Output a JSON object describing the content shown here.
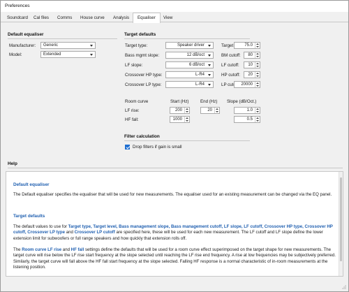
{
  "window": {
    "title": "Preferences"
  },
  "tabs": [
    {
      "label": "Soundcard"
    },
    {
      "label": "Cal files"
    },
    {
      "label": "Comms"
    },
    {
      "label": "House curve"
    },
    {
      "label": "Analysis"
    },
    {
      "label": "Equaliser"
    },
    {
      "label": "View"
    }
  ],
  "default_equaliser": {
    "title": "Default equaliser",
    "manufacturer_label": "Manufacturer:",
    "manufacturer_value": "Generic",
    "model_label": "Model:",
    "model_value": "Extended"
  },
  "target_defaults": {
    "title": "Target defaults",
    "target_type_label": "Target type:",
    "target_type_value": "Speaker driver",
    "bass_slope_label": "Bass mgmt slope:",
    "bass_slope_value": "12 dB/oct",
    "lf_slope_label": "LF slope:",
    "lf_slope_value": "6 dB/oct",
    "xover_hp_type_label": "Crossover HP type:",
    "xover_hp_type_value": "L-R4",
    "xover_lp_type_label": "Crossover LP type:",
    "xover_lp_type_value": "L-R4",
    "target_level_label": "Target level:",
    "target_level_value": "75.0",
    "bm_cutoff_label": "BM cutoff:",
    "bm_cutoff_value": "80",
    "lf_cutoff_label": "LF cutoff:",
    "lf_cutoff_value": "10",
    "hp_cutoff_label": "HP cutoff:",
    "hp_cutoff_value": "20",
    "lp_cutoff_label": "LP cutoff:",
    "lp_cutoff_value": "20000"
  },
  "room_curve": {
    "label": "Room curve",
    "start_header": "Start (Hz)",
    "end_header": "End (Hz)",
    "slope_header": "Slope (dB/Oct.)",
    "lf_rise_label": "LF rise:",
    "lf_rise_start": "200",
    "lf_rise_end": "20",
    "lf_rise_slope": "1.0",
    "hf_fall_label": "HF fall:",
    "hf_fall_start": "1000",
    "hf_fall_slope": "0.5"
  },
  "filter_calc": {
    "title": "Filter calculation",
    "drop_label": "Drop filters if gain is small",
    "drop_checked": true
  },
  "help": {
    "title": "Help",
    "h1": "Default equaliser",
    "p1": "The Default equaliser specifies the equaliser that will be used for new measurements. The equaliser used for an existing measurement can be changed via the EQ panel.",
    "h2": "Target defaults",
    "p2_a": "The default values to use for ",
    "p2_k1": "Target type, Target level, Bass management slope, Bass management cutoff, LF slope, LF cutoff, Crossover HP type, Crossover HP cutoff, Crossover LP type",
    "p2_b": " and ",
    "p2_k2": "Crossover LP cutoff",
    "p2_c": " are specified here, these will be used for each new measurement. The LF cutoff and LF slope define the lower extension limit for subwoofers or full range speakers and how quickly that extension rolls off.",
    "p3_a": "The ",
    "p3_k1": "Room curve LF rise",
    "p3_b": " and ",
    "p3_k2": "HF fall",
    "p3_c": " settings define the defaults that will be used for a room curve effect superimposed on the target shape for new measurements. The target curve will rise below the LF rise start frequency at the slope selected until reaching the LF rise end frequency. A rise at low frequencies may be subjectively preferred. Similarly, the target curve will fall above the HF fall start frequency at the slope selected. Falling HF response is a normal characteristic of in-room measurements at the listening position."
  }
}
